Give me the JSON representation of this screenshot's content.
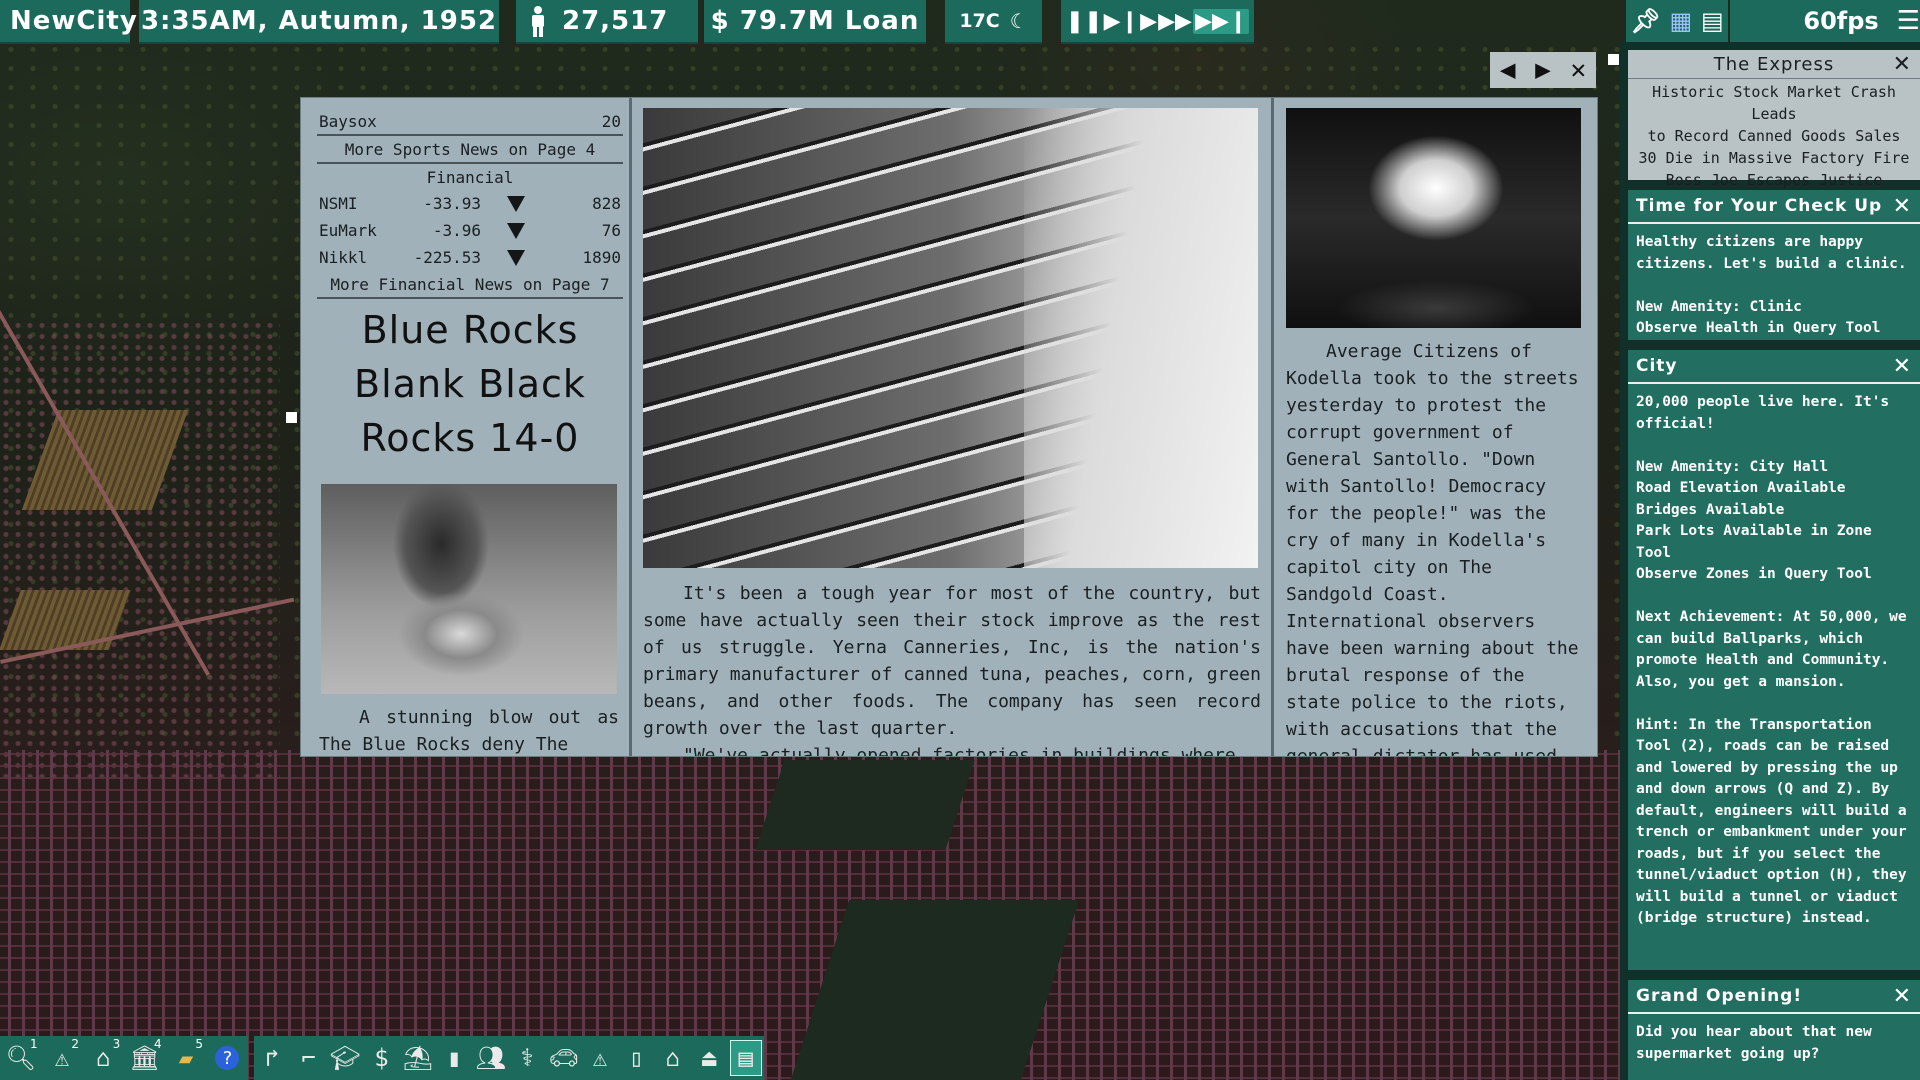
{
  "hud": {
    "city": "NewCity",
    "clock": "3:35AM, Autumn, 1952",
    "population": "27,517",
    "money": "$ 79.7M Loan",
    "temperature": "17C",
    "fps": "60fps"
  },
  "newspaper": {
    "sports": {
      "scores": [
        {
          "team": "Baysox",
          "score": "20"
        }
      ],
      "more_sports": "More Sports News on Page 4",
      "financial_title": "Financial",
      "stocks": [
        {
          "name": "NSMI",
          "change": "-33.93",
          "value": "828"
        },
        {
          "name": "EuMark",
          "change": "-3.96",
          "value": "76"
        },
        {
          "name": "Nikkl",
          "change": "-225.53",
          "value": "1890"
        }
      ],
      "more_financial": "More Financial News on Page 7",
      "headline_1": "Blue Rocks",
      "headline_2": "Blank Black",
      "headline_3": "Rocks 14-0",
      "article": "A stunning blow out as The Blue Rocks deny The"
    },
    "main_article": "It's been a tough year for most of the country, but some have actually seen their stock improve as the rest of us struggle. Yerna Canneries, Inc, is the nation's primary manufacturer of canned tuna, peaches, corn, green beans, and other foods. The company has seen record growth over the last quarter.",
    "main_article_cont": "\"We've actually opened factories in buildings where",
    "side_article": "Average Citizens of Kodella took to the streets yesterday to protest the corrupt government of General Santollo. \"Down with Santollo! Democracy for the people!\" was the cry of many in Kodella's capitol city on The Sandgold Coast. International observers have been warning about the brutal response of the state police to the riots, with accusations that the general dictator has used"
  },
  "express": {
    "title": "The Express",
    "headlines": [
      "Historic Stock Market Crash Leads",
      "to Record Canned Goods Sales",
      "30 Die in Massive Factory Fire",
      "Boss Joe Escapes Justice"
    ]
  },
  "notifications": [
    {
      "title": "Time for Your Check Up",
      "body": "Healthy citizens are happy citizens. Let's build a clinic.\n\nNew Amenity: Clinic\nObserve Health in Query Tool"
    },
    {
      "title": "City",
      "body": "20,000 people live here. It's official!\n\nNew Amenity: City Hall\nRoad Elevation Available\nBridges Available\nPark Lots Available in Zone Tool\nObserve Zones in Query Tool\n\nNext Achievement: At 50,000, we can build Ballparks, which promote Health and Community. Also, you get a mansion.\n\nHint: In the Transportation Tool (2), roads can be raised and lowered by pressing the up and down arrows (Q and Z). By default, engineers will build a trench or embankment under your roads, but if you select the tunnel/viaduct option (H), they will build a tunnel or viaduct (bridge structure) instead."
    },
    {
      "title": "Grand Opening!",
      "body": "Did you hear about that new supermarket going up?\n\nNew Amenity: Small Park"
    }
  ],
  "toolbar": {
    "tool_numbers": [
      "1",
      "2",
      "3",
      "4",
      "5"
    ]
  },
  "colors": {
    "hud": "#1b6a5c",
    "paper": "#a0b1b9",
    "card": "#226f61"
  }
}
